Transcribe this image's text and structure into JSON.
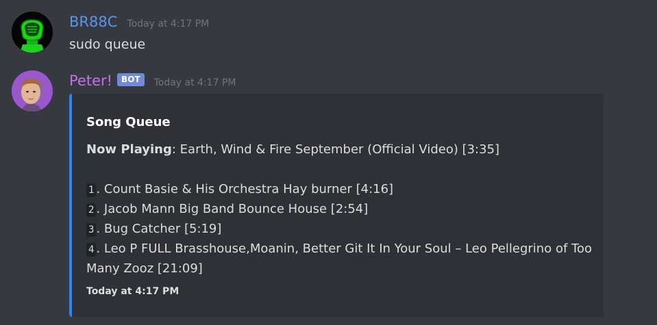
{
  "messages": [
    {
      "username": "BR88C",
      "timestamp": "Today at 4:17 PM",
      "text": "sudo queue",
      "avatar_icon": "green-robot-avatar",
      "name_color": "#5a96ef"
    },
    {
      "username": "Peter!",
      "bot_tag": "BOT",
      "timestamp": "Today at 4:17 PM",
      "avatar_icon": "photo-avatar",
      "name_color": "#c86ff0",
      "embed": {
        "accent_color": "#2b87f7",
        "title": "Song Queue",
        "now_playing_label": "Now Playing",
        "now_playing_value": ": Earth, Wind & Fire September (Official Video) [3:35]",
        "queue": [
          {
            "num": "1",
            "text": ". Count Basie & His Orchestra Hay burner [4:16]"
          },
          {
            "num": "2",
            "text": ". Jacob Mann Big Band Bounce House [2:54]"
          },
          {
            "num": "3",
            "text": ". Bug Catcher [5:19]"
          },
          {
            "num": "4",
            "text": ". Leo P FULL Brasshouse,Moanin, Better Git It In Your Soul – Leo Pellegrino of Too Many Zooz [21:09]"
          }
        ],
        "footer": "Today at 4:17 PM"
      }
    }
  ]
}
